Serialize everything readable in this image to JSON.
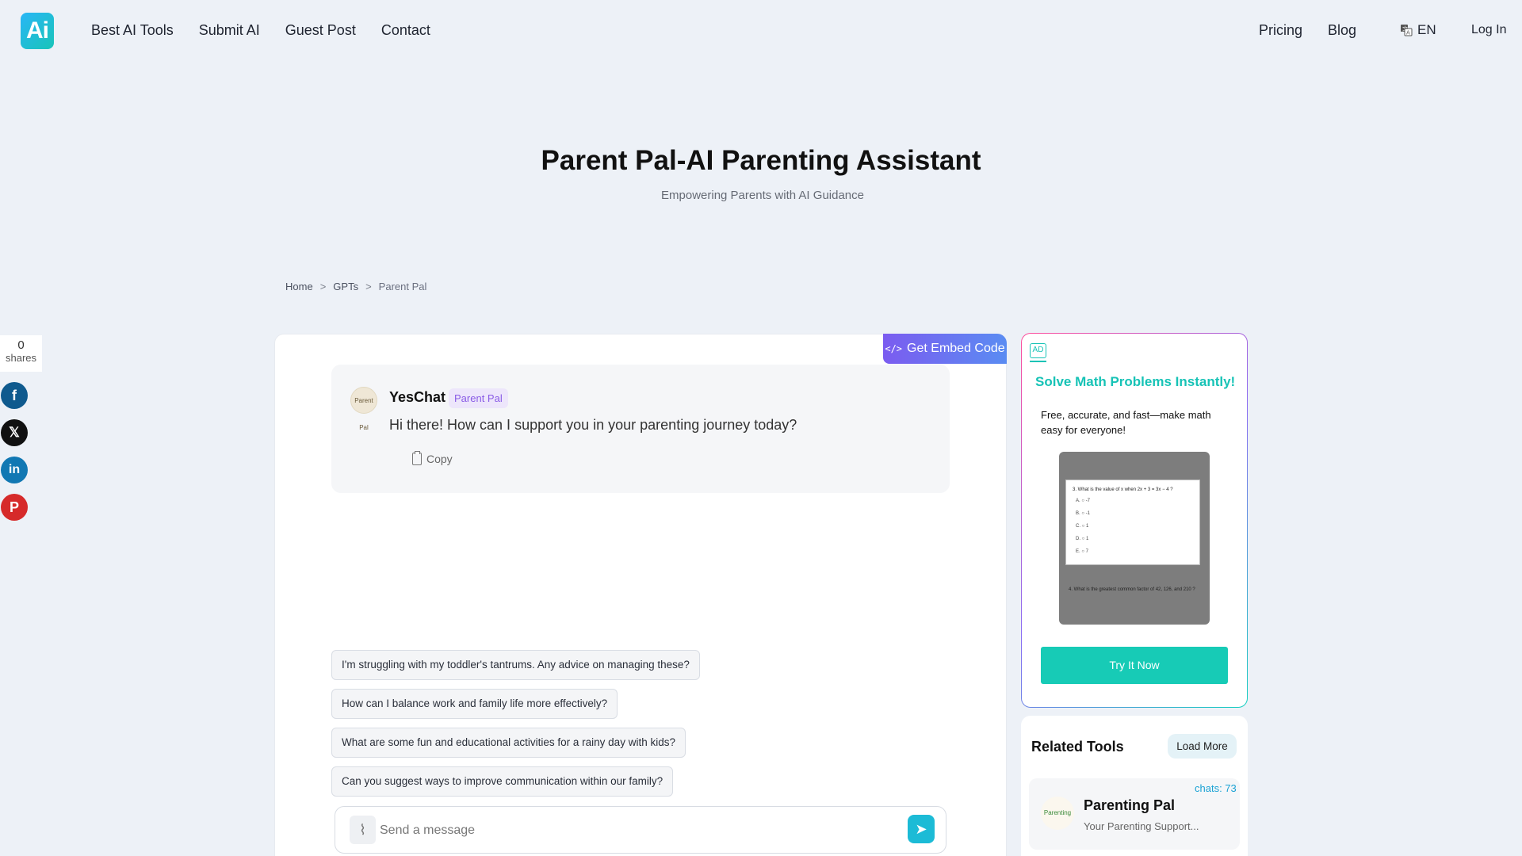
{
  "nav": {
    "logo_text": "Ai",
    "links": [
      "Best AI Tools",
      "Submit AI",
      "Guest Post",
      "Contact"
    ],
    "pricing": "Pricing",
    "blog": "Blog",
    "language": "EN",
    "login": "Log In"
  },
  "hero": {
    "title": "Parent Pal-AI Parenting Assistant",
    "subtitle": "Empowering Parents with AI Guidance"
  },
  "breadcrumb": {
    "home": "Home",
    "sep": ">",
    "gpts": "GPTs",
    "current": "Parent Pal"
  },
  "share": {
    "count": "0",
    "label": "shares",
    "icons": [
      "facebook-icon",
      "x-icon",
      "linkedin-icon",
      "pinterest-icon"
    ]
  },
  "chat": {
    "embed_label": "Get Embed Code",
    "bot_name": "YesChat",
    "bot_badge": "Parent Pal",
    "bot_avatar_text": "Parent Pal",
    "greeting": "Hi there! How can I support you in your parenting journey today?",
    "copy_label": "Copy",
    "suggestions": [
      "I'm struggling with my toddler's tantrums. Any advice on managing these?",
      "How can I balance work and family life more effectively?",
      "What are some fun and educational activities for a rainy day with kids?",
      "Can you suggest ways to improve communication within our family?"
    ],
    "input_placeholder": "Send a message"
  },
  "ad": {
    "tag": "AD",
    "title": "Solve Math Problems Instantly!",
    "description": "Free, accurate, and fast—make math easy for everyone!",
    "image_question": "3. What is the value of x when 2x + 3 = 3x − 4 ?",
    "image_options": [
      "A. ○ -7",
      "B. ○ -1",
      "C. ○ 1",
      "D. ○ 1",
      "E. ○ 7"
    ],
    "image_question2": "4. What is the greatest common factor of 42, 126, and 210 ?",
    "button": "Try It Now"
  },
  "related": {
    "title": "Related Tools",
    "load_more": "Load More",
    "items": [
      {
        "chats": "chats: 73",
        "name": "Parenting Pal",
        "desc": "Your Parenting Support...",
        "logo_text": "Parenting"
      }
    ]
  },
  "colors": {
    "page_bg": "#edf1f7",
    "accent_teal": "#17c3b6",
    "embed_gradient_start": "#7b5cf0",
    "embed_gradient_end": "#5a8cf2",
    "badge_purple": "#8a5ce6",
    "send_button": "#1cbbd6"
  }
}
